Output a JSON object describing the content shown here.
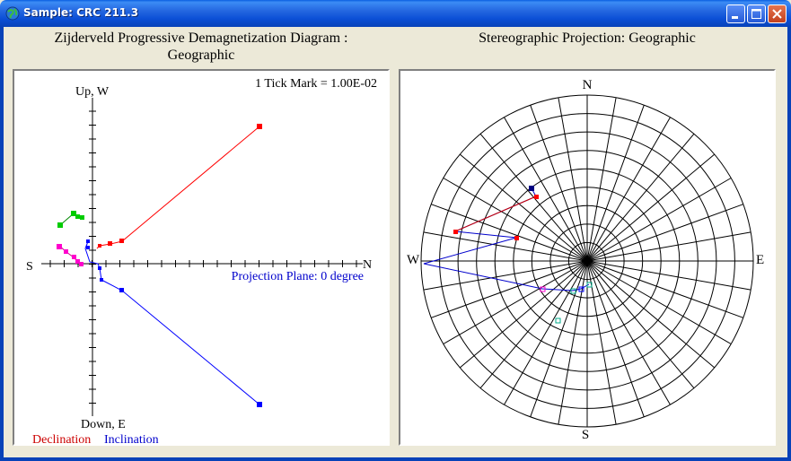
{
  "window": {
    "title": "Sample: CRC  211.3",
    "minimize_icon": "minimize-icon",
    "maximize_icon": "maximize-icon",
    "close_icon": "close-icon"
  },
  "zijderveld": {
    "title_line1": "Zijderveld Progressive Demagnetization Diagram :",
    "title_line2": "Geographic",
    "tick_note": "1 Tick Mark = 1.00E-02",
    "axis_up": "Up, W",
    "axis_down": "Down, E",
    "axis_n": "N",
    "axis_s": "S",
    "projection_plane": "Projection Plane: 0 degree",
    "legend_declination": "Declination",
    "legend_inclination": "Inclination",
    "colors": {
      "declination": "#ff0000",
      "inclination": "#0000ff",
      "green": "#00cc00",
      "magenta": "#ff00cc",
      "axis": "#000000",
      "marker": "#0000cc"
    }
  },
  "stereonet": {
    "title": "Stereographic Projection: Geographic",
    "label_n": "N",
    "label_s": "S",
    "label_e": "E",
    "label_w": "W"
  }
}
